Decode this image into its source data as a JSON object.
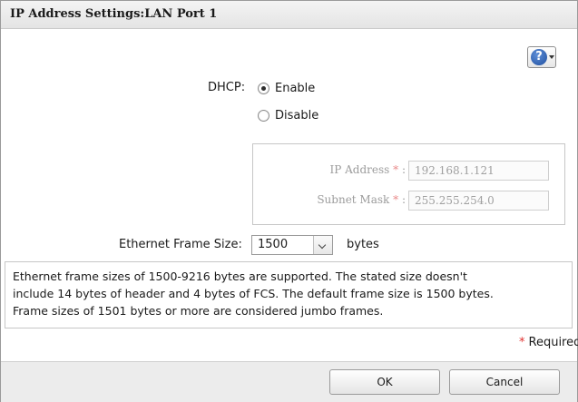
{
  "dialog": {
    "title": "IP Address Settings:LAN Port 1"
  },
  "help": {
    "glyph": "?",
    "icon": "help-question-icon"
  },
  "dhcp": {
    "label": "DHCP:",
    "options": [
      {
        "label": "Enable",
        "checked": true
      },
      {
        "label": "Disable",
        "checked": false
      }
    ]
  },
  "ip_settings": {
    "ip_address": {
      "label": "IP Address",
      "required_mark": "*",
      "colon": ":",
      "value": "192.168.1.121"
    },
    "subnet_mask": {
      "label": "Subnet Mask",
      "required_mark": "*",
      "colon": ":",
      "value": "255.255.254.0"
    }
  },
  "frame_size": {
    "label": "Ethernet Frame Size:",
    "selected": "1500",
    "unit": "bytes"
  },
  "info": {
    "lines": [
      "Ethernet frame sizes of 1500-9216 bytes are supported. The stated size doesn't",
      "include 14 bytes of header and 4 bytes of FCS. The default frame size is 1500 bytes.",
      "Frame sizes of 1501 bytes or more are considered jumbo frames."
    ]
  },
  "required_note": {
    "mark": "*",
    "text": "Required"
  },
  "buttons": {
    "ok": "OK",
    "cancel": "Cancel"
  },
  "colors": {
    "required": "#e0302f",
    "help_blue": "#1f4f9f"
  }
}
